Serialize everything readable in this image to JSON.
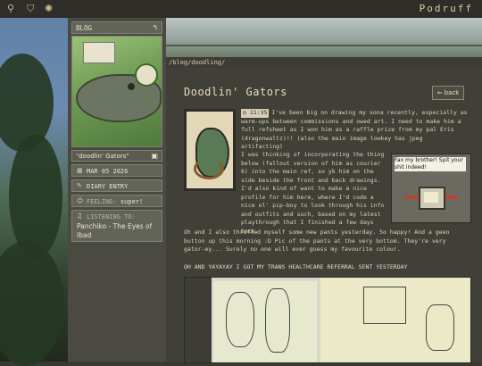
{
  "site": {
    "brand": "Podruff"
  },
  "topbar": {
    "icons": [
      "bicycle-icon",
      "tooth-icon",
      "sun-icon"
    ]
  },
  "sidebar": {
    "blog_label": "BLOG",
    "post_title": "\"doodlin' Gators\"",
    "date": "MAR 05 2026",
    "entry_type": "DIARY ENTRY",
    "feeling_label": "FEELING:",
    "feeling_value": "super!",
    "listening_label": "LISTENING TO:",
    "listening_value": "Panchiko - The Eyes of Ibad"
  },
  "breadcrumb": "/blog/doodling/",
  "post": {
    "title": "Doodlin' Gators",
    "back_label": "back",
    "time": "11:35",
    "p1": "I've been big on drawing my sona recently, especially as warm-ups between commissions and owed art. I need to make him a full refsheet as I won him as a raffle prize from my pal Eris (dragonwaltz)!! (also the main image lowkey has jpeg artifacting)",
    "p2": "I was thinking of incorporating the thing below (fallout version of him as courier 6) into the main ref, so yk him on the side beside the front and back drawings. I'd also kind of want to make a nice profile for him here, where I'd code a nice ol' pip-boy to look through his info and outfits and such, based on my latest playthrough that I finished a few days back.",
    "p3": "Oh and I also thrifted myself some new pants yesterday. So happy! And a geen button up this morning :D Pic of the pants at the very bottom. They're very gator-ey... Surely no one will ever guess my favourite colour.",
    "p4": "OH AND YAYAYAY I GOT MY TRANS HEALTHCARE REFERRAL SENT YESTERDAY",
    "meme_caption": "Fax my brother! Spit your shit indeed!"
  },
  "colors": {
    "panel": "#62645a",
    "main_bg": "#403f38",
    "text": "#ddd3b8"
  }
}
